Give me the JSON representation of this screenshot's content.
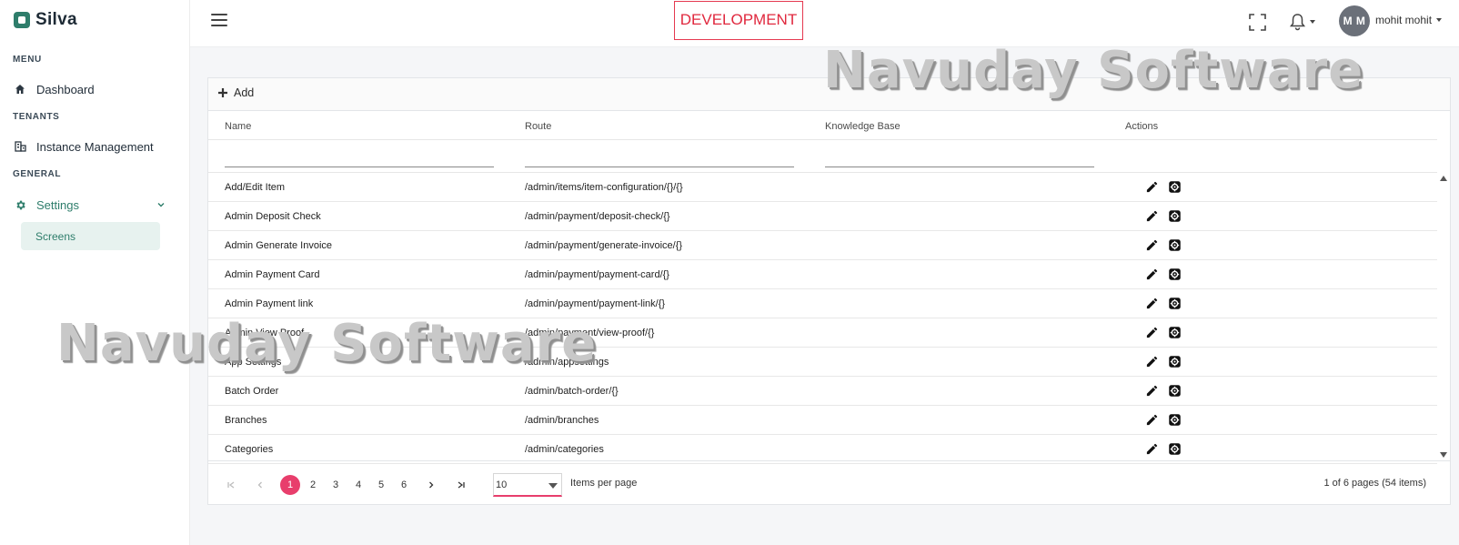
{
  "brand": {
    "name": "Silva"
  },
  "sidebar": {
    "sections": {
      "menu": "MENU",
      "tenants": "TENANTS",
      "general": "GENERAL"
    },
    "items": {
      "dashboard": "Dashboard",
      "instance_management": "Instance Management",
      "settings": "Settings",
      "screens": "Screens"
    }
  },
  "header": {
    "environment": "DEVELOPMENT",
    "avatar_initials": "M M",
    "user_name": "mohit mohit"
  },
  "grid": {
    "add_label": "Add",
    "columns": [
      "Name",
      "Route",
      "Knowledge Base",
      "Actions"
    ],
    "rows": [
      {
        "name": "Add/Edit Item",
        "route": "/admin/items/item-configuration/{}/{}",
        "kb": ""
      },
      {
        "name": "Admin Deposit Check",
        "route": "/admin/payment/deposit-check/{}",
        "kb": ""
      },
      {
        "name": "Admin Generate Invoice",
        "route": "/admin/payment/generate-invoice/{}",
        "kb": ""
      },
      {
        "name": "Admin Payment Card",
        "route": "/admin/payment/payment-card/{}",
        "kb": ""
      },
      {
        "name": "Admin Payment link",
        "route": "/admin/payment/payment-link/{}",
        "kb": ""
      },
      {
        "name": "Admin View Proof",
        "route": "/admin/payment/view-proof/{}",
        "kb": ""
      },
      {
        "name": "App Settings",
        "route": "/admin/appsettings",
        "kb": ""
      },
      {
        "name": "Batch Order",
        "route": "/admin/batch-order/{}",
        "kb": ""
      },
      {
        "name": "Branches",
        "route": "/admin/branches",
        "kb": ""
      },
      {
        "name": "Categories",
        "route": "/admin/categories",
        "kb": ""
      }
    ]
  },
  "pager": {
    "pages": [
      "1",
      "2",
      "3",
      "4",
      "5",
      "6"
    ],
    "current_page": "1",
    "page_size": "10",
    "items_per_page_label": "Items per page",
    "info": "1 of 6 pages (54 items)"
  },
  "watermark": {
    "text": "Navuday Software"
  },
  "colors": {
    "brand": "#2e7d6b",
    "accent": "#e83e6c",
    "environment": "#e0283e"
  }
}
